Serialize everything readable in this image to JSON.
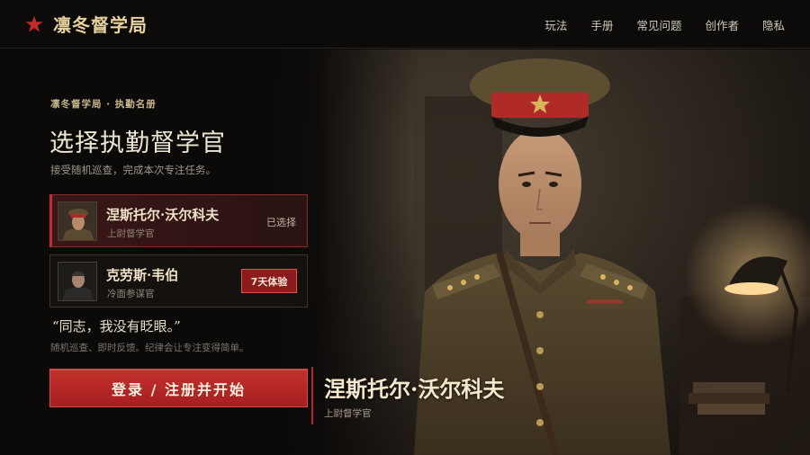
{
  "header": {
    "brand_name": "凛冬督学局",
    "brand_icon": "red-star-icon",
    "brand_color": "#c42a28",
    "nav": [
      {
        "label": "玩法"
      },
      {
        "label": "手册"
      },
      {
        "label": "常见问题"
      },
      {
        "label": "创作者"
      },
      {
        "label": "隐私"
      }
    ]
  },
  "panel": {
    "eyebrow": "凛冬督学局 · 执勤名册",
    "title": "选择执勤督学官",
    "subtitle": "接受随机巡查，完成本次专注任务。",
    "officers": [
      {
        "name": "涅斯托尔·沃尔科夫",
        "role": "上尉督学官",
        "status": "已选择",
        "selected": true
      },
      {
        "name": "克劳斯·韦伯",
        "role": "冷面参谋官",
        "action": "7天体验",
        "selected": false
      }
    ],
    "quote": "“同志，我没有眨眼。”",
    "quote_desc": "随机巡查、即时反馈。纪律会让专注变得简单。",
    "cta": "登录 / 注册并开始"
  },
  "hero": {
    "name": "涅斯托尔·沃尔科夫",
    "role": "上尉督学官"
  },
  "colors": {
    "accent": "#c42a28",
    "gold": "#e6d29a",
    "background": "#0c0a09"
  }
}
